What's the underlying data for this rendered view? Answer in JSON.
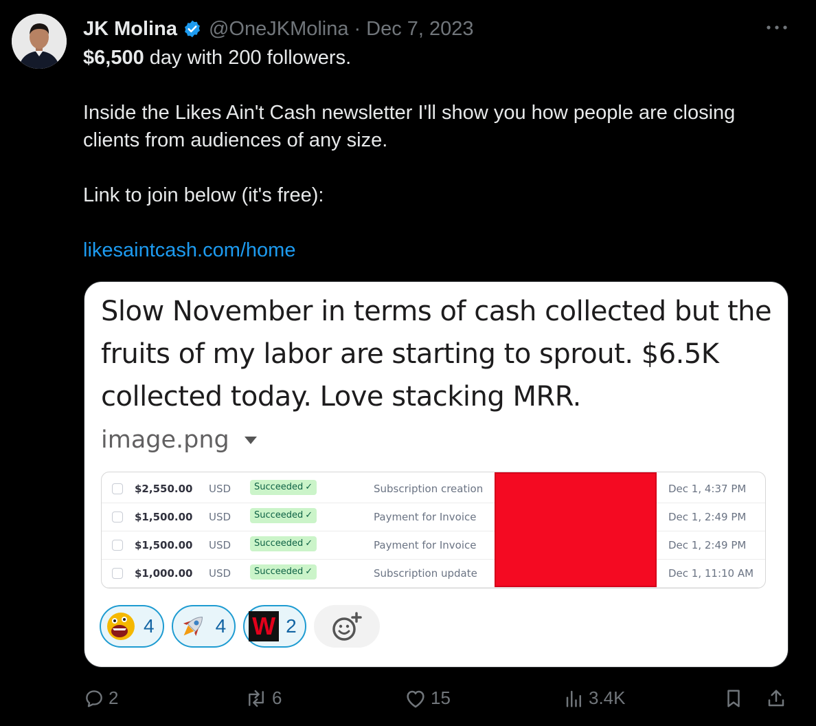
{
  "tweet": {
    "author_name": "JK Molina",
    "handle": "@OneJKMolina",
    "separator": "·",
    "date": "Dec 7, 2023",
    "line1_bold": "$6,500",
    "line1_rest": " day with 200 followers.",
    "para2_line1": "Inside the Likes Ain't Cash newsletter I'll show you how people are closing",
    "para2_line2": "clients from audiences of any size.",
    "para3": "Link to join below (it's free):",
    "link": "likesaintcash.com/home"
  },
  "card": {
    "message_line1": "Slow November in terms of cash collected but the",
    "message_line2": "fruits of my labor are starting to sprout. $6.5K",
    "message_line3": "collected today. Love stacking MRR.",
    "file_name": "image.png",
    "payments": [
      {
        "amount": "$2,550.00",
        "currency": "USD",
        "status": "Succeeded",
        "description": "Subscription creation",
        "date": "Dec 1, 4:37 PM"
      },
      {
        "amount": "$1,500.00",
        "currency": "USD",
        "status": "Succeeded",
        "description": "Payment for Invoice",
        "date": "Dec 1, 2:49 PM"
      },
      {
        "amount": "$1,500.00",
        "currency": "USD",
        "status": "Succeeded",
        "description": "Payment for Invoice",
        "date": "Dec 1, 2:49 PM"
      },
      {
        "amount": "$1,000.00",
        "currency": "USD",
        "status": "Succeeded",
        "description": "Subscription update",
        "date": "Dec 1, 11:10 AM"
      }
    ],
    "reactions": [
      {
        "icon": "screaming-face-icon",
        "count": "4"
      },
      {
        "icon": "rocket-icon",
        "count": "4"
      },
      {
        "icon": "w-logo-icon",
        "letter": "W",
        "count": "2"
      }
    ]
  },
  "actions": {
    "replies": "2",
    "reposts": "6",
    "likes": "15",
    "views": "3.4K"
  },
  "colors": {
    "background": "#000000",
    "text": "#e7e9ea",
    "muted": "#71767b",
    "link": "#1d9bf0",
    "verified": "#1d9bf0",
    "redaction": "#f40a22",
    "status_bg": "#cbf4c9"
  }
}
